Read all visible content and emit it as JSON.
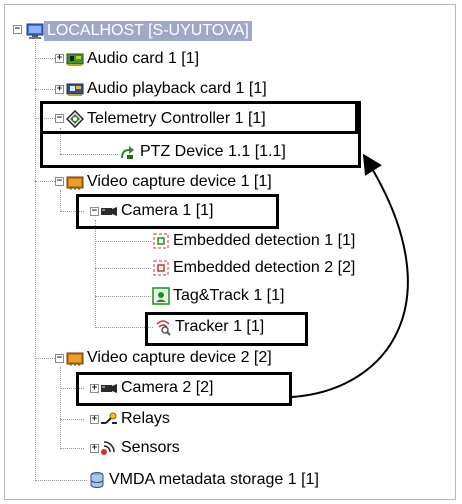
{
  "tree": {
    "root": {
      "label": "LOCALHOST [S-UYUTOVA]",
      "expander": "⊟",
      "icon": "computer-icon"
    },
    "items": [
      {
        "label": "Audio card 1 [1]",
        "icon": "audio-card-icon",
        "expander": "+"
      },
      {
        "label": "Audio playback card 1 [1]",
        "icon": "audio-playback-icon",
        "expander": "+"
      },
      {
        "label": "Telemetry Controller 1 [1]",
        "icon": "telemetry-icon",
        "expander": "−"
      },
      {
        "label": "PTZ Device 1.1 [1.1]",
        "icon": "ptz-icon"
      },
      {
        "label": "Video capture device 1 [1]",
        "icon": "video-capture-icon",
        "expander": "−"
      },
      {
        "label": "Camera 1 [1]",
        "icon": "camera-icon",
        "expander": "−"
      },
      {
        "label": "Embedded detection 1 [1]",
        "icon": "detection-icon"
      },
      {
        "label": "Embedded detection 2 [2]",
        "icon": "detection-icon"
      },
      {
        "label": "Tag&Track 1 [1]",
        "icon": "tagtrack-icon"
      },
      {
        "label": "Tracker 1 [1]",
        "icon": "tracker-icon"
      },
      {
        "label": "Video capture device 2 [2]",
        "icon": "video-capture-icon",
        "expander": "−"
      },
      {
        "label": "Camera 2 [2]",
        "icon": "camera-icon",
        "expander": "+"
      },
      {
        "label": "Relays",
        "icon": "relay-icon",
        "expander": "+"
      },
      {
        "label": "Sensors",
        "icon": "sensor-icon",
        "expander": "+"
      },
      {
        "label": "VMDA metadata storage 1 [1]",
        "icon": "database-icon"
      }
    ]
  },
  "colors": {
    "selection": "#9fa8c9",
    "highlight_box": "#000000",
    "arrow": "#000000"
  }
}
